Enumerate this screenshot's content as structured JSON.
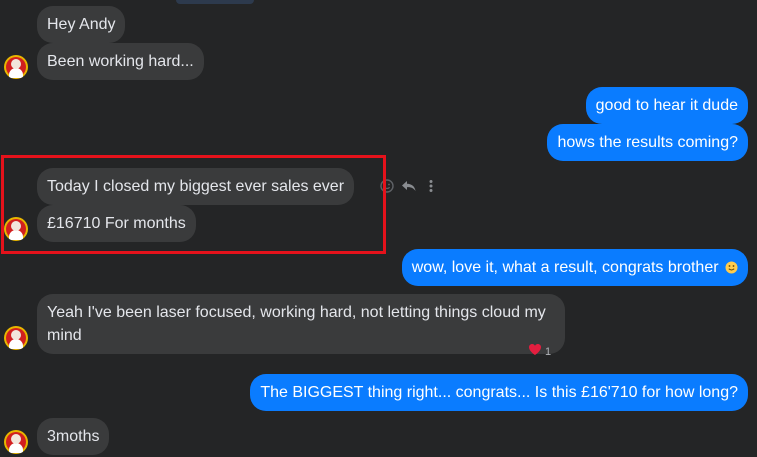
{
  "colors": {
    "background": "#242526",
    "incoming_bubble": "#3a3b3c",
    "outgoing_bubble": "#0a7cff",
    "highlight_box": "#e5121b",
    "reaction_heart": "#e41e3f"
  },
  "messages": {
    "m1": {
      "text": "Hey Andy"
    },
    "m2": {
      "text": "Been working hard..."
    },
    "m3": {
      "text": "good to hear it dude"
    },
    "m4": {
      "text": "hows the results coming?"
    },
    "m5": {
      "text": "Today I closed my biggest ever sales ever"
    },
    "m6": {
      "text": "£16710 For months"
    },
    "m7": {
      "text": "wow, love it, what a result, congrats brother"
    },
    "m8": {
      "text": "Yeah I've been laser focused, working hard, not letting things cloud my mind"
    },
    "m9": {
      "text": "The BIGGEST thing right... congrats... Is this £16'710 for how long?"
    },
    "m10": {
      "text": "3moths"
    }
  },
  "reaction": {
    "icon": "heart-icon",
    "count": "1"
  },
  "icons": {
    "react": "smiley-outline-icon",
    "reply": "reply-arrow-icon",
    "more": "more-vertical-icon",
    "emoji_in_m7": "slightly-smiling-face-icon"
  }
}
